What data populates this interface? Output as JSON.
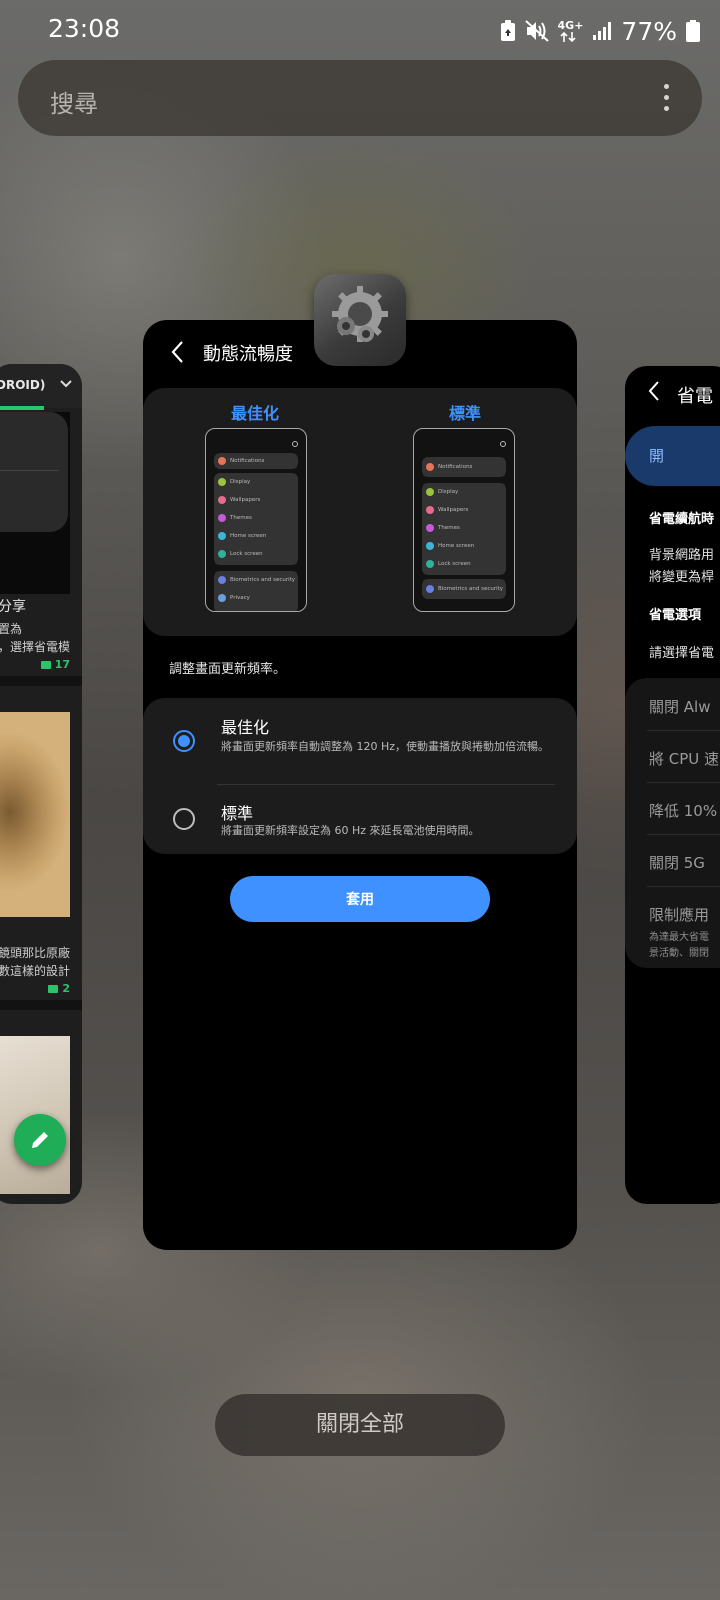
{
  "status_bar": {
    "time": "23:08",
    "network": "4G+",
    "battery": "77%"
  },
  "search": {
    "placeholder": "搜尋"
  },
  "left_card": {
    "header": "DROID)",
    "line1": "分享",
    "line2": "置為",
    "line3": "，選擇省電模",
    "count1": "17",
    "line4": "鏡頭那比原廠",
    "line5": "數這樣的設計",
    "count2": "2"
  },
  "center_card": {
    "title": "動態流暢度",
    "preview_optimized_label": "最佳化",
    "preview_standard_label": "標準",
    "phone_items": [
      "Notifications",
      "Display",
      "Wallpapers",
      "Themes",
      "Home screen",
      "Lock screen",
      "Biometrics and security",
      "Privacy"
    ],
    "description": "調整畫面更新頻率。",
    "options": [
      {
        "title": "最佳化",
        "subtitle": "將畫面更新頻率自動調整為 120 Hz，使動畫播放與捲動加倍流暢。",
        "selected": true
      },
      {
        "title": "標準",
        "subtitle": "將畫面更新頻率設定為 60 Hz 來延長電池使用時間。",
        "selected": false
      }
    ],
    "apply_label": "套用"
  },
  "right_card": {
    "title": "省電",
    "on_label": "開",
    "heading1": "省電續航時",
    "text1": "背景網路用",
    "text2": "將變更為桿",
    "heading2": "省電選項",
    "text3": "請選擇省電",
    "items": [
      "關閉 Alw",
      "將 CPU 速",
      "降低 10%",
      "關閉 5G",
      "限制應用"
    ],
    "sub1": "為達最大省電",
    "sub2": "景活動、關閉"
  },
  "close_all_label": "關閉全部",
  "colors": {
    "accent": "#3e91ff",
    "green": "#26c76e"
  }
}
